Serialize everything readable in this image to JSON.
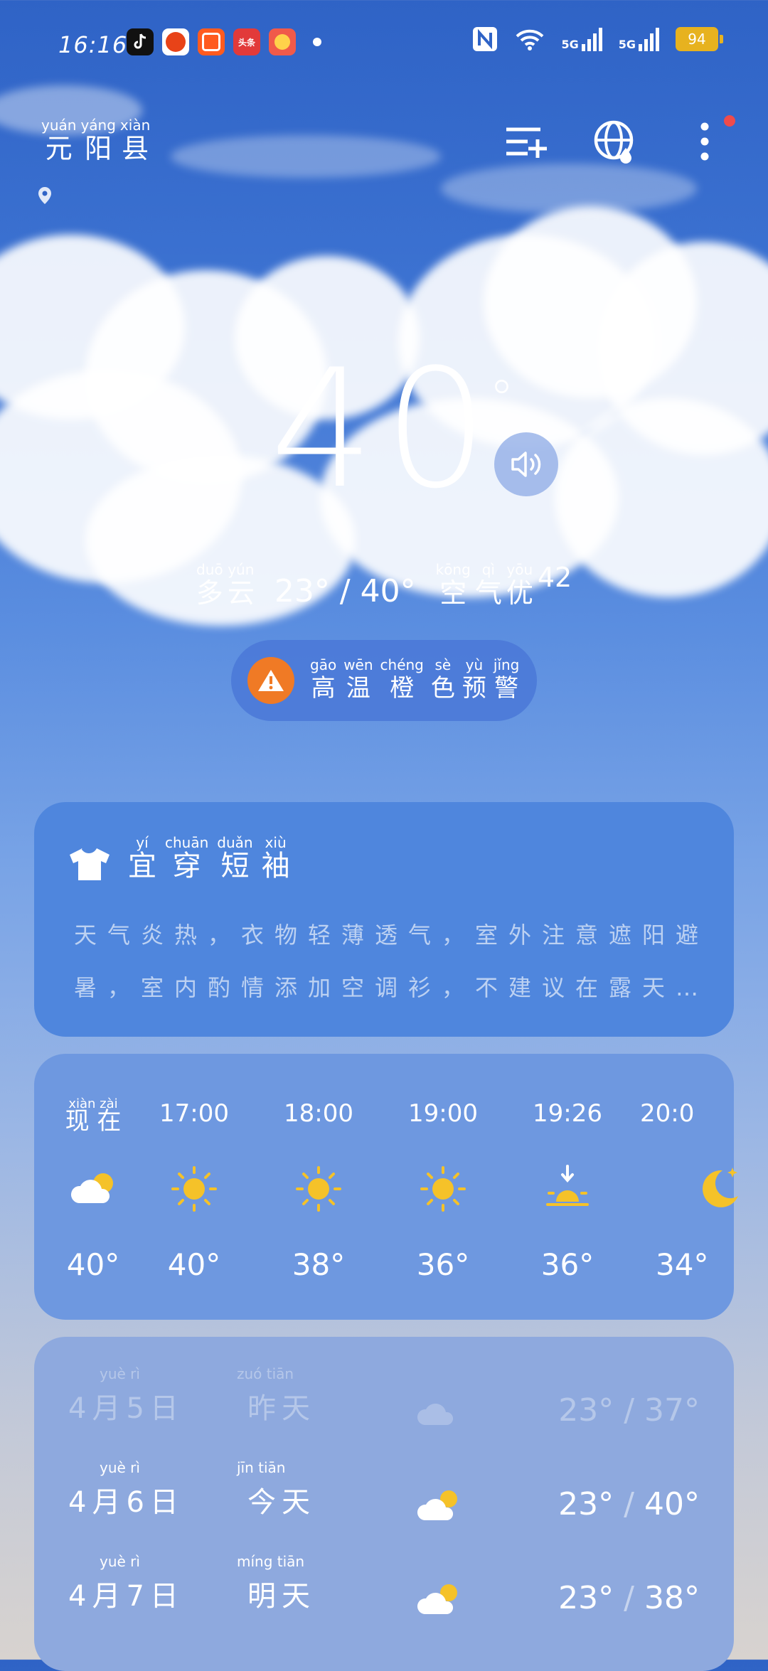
{
  "status_bar": {
    "time": "16:16",
    "battery": "94",
    "network_1": "5G",
    "network_2": "5G",
    "app_icons": [
      "tiktok-icon",
      "app-icon-orange",
      "kuaishou-icon",
      "toutiao-icon",
      "game-app-icon"
    ],
    "toutiao_label": "头条"
  },
  "location": {
    "city_pinyin": [
      "yuán",
      "yáng",
      "xiàn"
    ],
    "city_chars": [
      "元",
      "阳",
      "县"
    ]
  },
  "current": {
    "temperature": "40",
    "degree_symbol": "°",
    "condition_pinyin": [
      "duō",
      "yún"
    ],
    "condition_chars": [
      "多",
      "云"
    ],
    "range": "23° / 40°",
    "aqi_pinyin": [
      "kōng",
      "qì",
      "yōu"
    ],
    "aqi_chars": [
      "空",
      "气",
      "优"
    ],
    "aqi_value": "42"
  },
  "alert": {
    "pinyin": [
      "gāo",
      "wēn",
      "chéng",
      "sè",
      "yù",
      "jǐng"
    ],
    "chars": [
      "高",
      "温",
      "橙",
      "色",
      "预",
      "警"
    ]
  },
  "dressing": {
    "title_pinyin": [
      "yí",
      "chuān",
      "duǎn",
      "xiù"
    ],
    "title_chars": [
      "宜",
      "穿",
      "短",
      "袖"
    ],
    "desc_line1": "天气炎热，衣物轻薄透气，室外注意遮阳避",
    "desc_line2": "暑，室内酌情添加空调衫，不建议在露天…"
  },
  "hourly": [
    {
      "label": "现 在",
      "label_pinyin": "xiàn zài",
      "icon": "partly-cloudy-icon",
      "temp": "40°"
    },
    {
      "label": "17:00",
      "icon": "sun-icon",
      "temp": "40°"
    },
    {
      "label": "18:00",
      "icon": "sun-icon",
      "temp": "38°"
    },
    {
      "label": "19:00",
      "icon": "sun-icon",
      "temp": "36°"
    },
    {
      "label": "19:26",
      "icon": "sunset-icon",
      "temp": "36°"
    },
    {
      "label": "20:0",
      "icon": "moon-icon",
      "temp": "34°"
    }
  ],
  "daily": [
    {
      "date": "4月5日",
      "date_pinyin": "yuè rì",
      "name": "昨天",
      "name_pinyin": "zuó tiān",
      "icon": "cloud-icon",
      "low": "23°",
      "high": "37°"
    },
    {
      "date": "4月6日",
      "date_pinyin": "yuè rì",
      "name": "今天",
      "name_pinyin": "jīn tiān",
      "icon": "partly-cloudy-icon",
      "low": "23°",
      "high": "40°"
    },
    {
      "date": "4月7日",
      "date_pinyin": "yuè rì",
      "name": "明天",
      "name_pinyin": "míng tiān",
      "icon": "partly-cloudy-icon",
      "low": "23°",
      "high": "38°"
    }
  ],
  "colors": {
    "sun": "#f5c229",
    "alert": "#f07a25",
    "notification_dot": "#ef4b4b"
  }
}
